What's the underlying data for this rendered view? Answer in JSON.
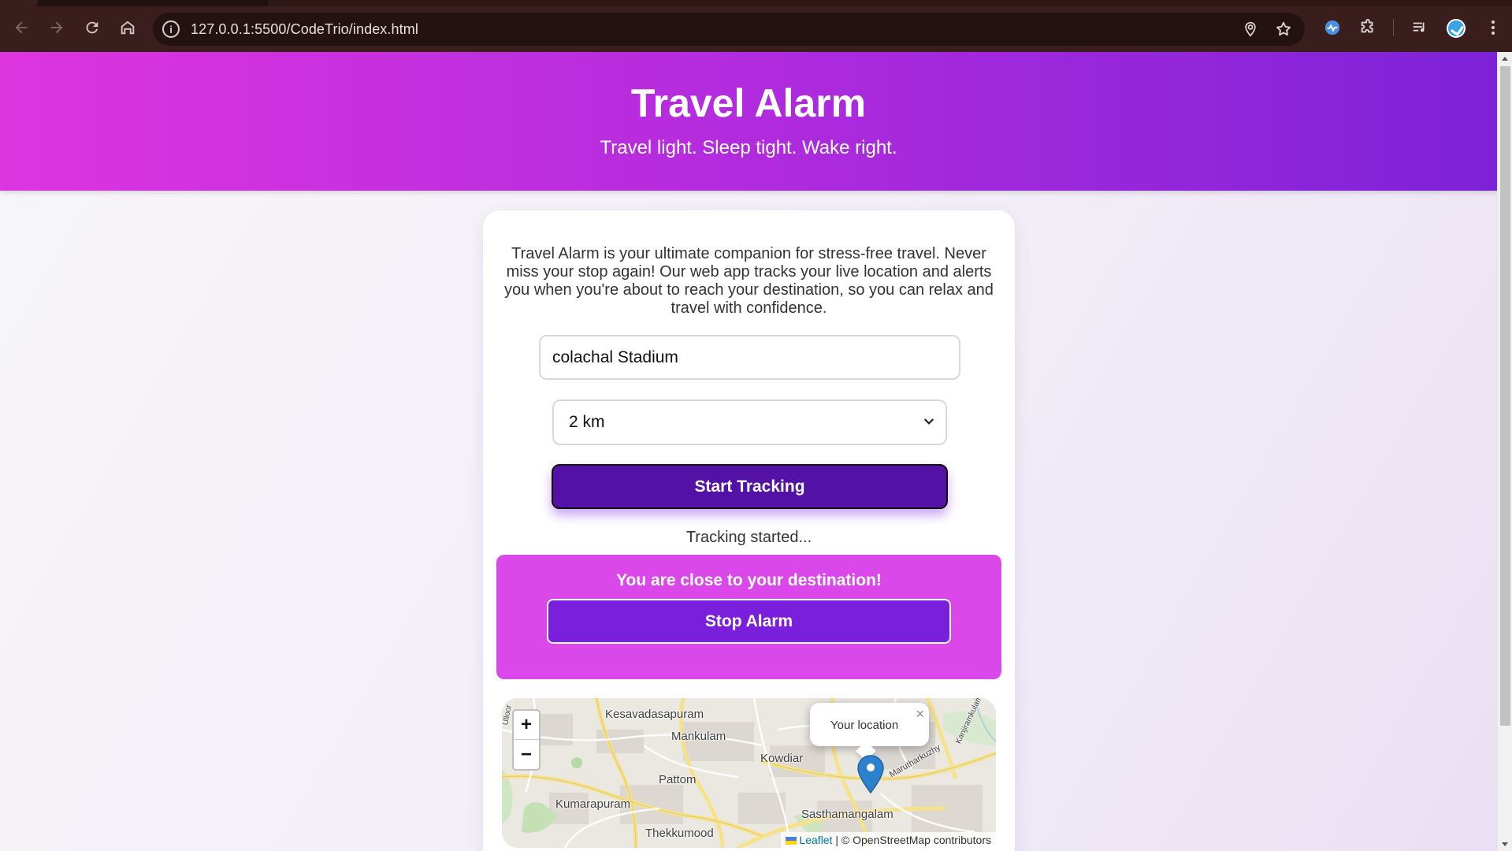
{
  "browser": {
    "url": "127.0.0.1:5500/CodeTrio/index.html",
    "icons": {
      "back": "arrow-left-icon",
      "forward": "arrow-right-icon",
      "reload": "reload-icon",
      "home": "home-icon",
      "site_info": "info-icon",
      "location": "location-pin-icon",
      "bookmark": "star-icon",
      "extension_active": "extension-status-icon",
      "extensions": "puzzle-icon",
      "media": "media-queue-icon",
      "profile": "avatar",
      "menu": "kebab-menu-icon"
    }
  },
  "hero": {
    "title": "Travel Alarm",
    "tagline": "Travel light. Sleep tight. Wake right."
  },
  "main": {
    "about": "Travel Alarm is your ultimate companion for stress-free travel. Never miss your stop again! Our web app tracks your live location and alerts you when you're about to reach your destination, so you can relax and travel with confidence.",
    "destination_value": "colachal Stadium",
    "range_selected": "2 km",
    "start_label": "Start Tracking",
    "status": "Tracking started...",
    "alert_message": "You are close to your destination!",
    "stop_label": "Stop Alarm"
  },
  "map": {
    "zoom_in": "+",
    "zoom_out": "−",
    "popup_text": "Your location",
    "popup_close": "×",
    "places": {
      "kesavadasapuram": "Kesavadasapuram",
      "mankulam": "Mankulam",
      "kowdiar": "Kowdiar",
      "pattom": "Pattom",
      "kumarapuram": "Kumarapuram",
      "sasthamangalam": "Sasthamangalam",
      "thekkumood": "Thekkumood",
      "marutharkuzhy": "Marutharkuzhy",
      "kanjiramkulam": "Kanjiramkulam",
      "ulloor": "Ulloor"
    },
    "attribution_link": "Leaflet",
    "attribution_rest": " | © OpenStreetMap contributors"
  },
  "colors": {
    "hero_start": "#dd35e0",
    "hero_end": "#7d22d8",
    "start_button": "#5411a5",
    "alert_background": "#db48e9",
    "stop_button": "#7a1fdb",
    "marker": "#2b82cb"
  }
}
